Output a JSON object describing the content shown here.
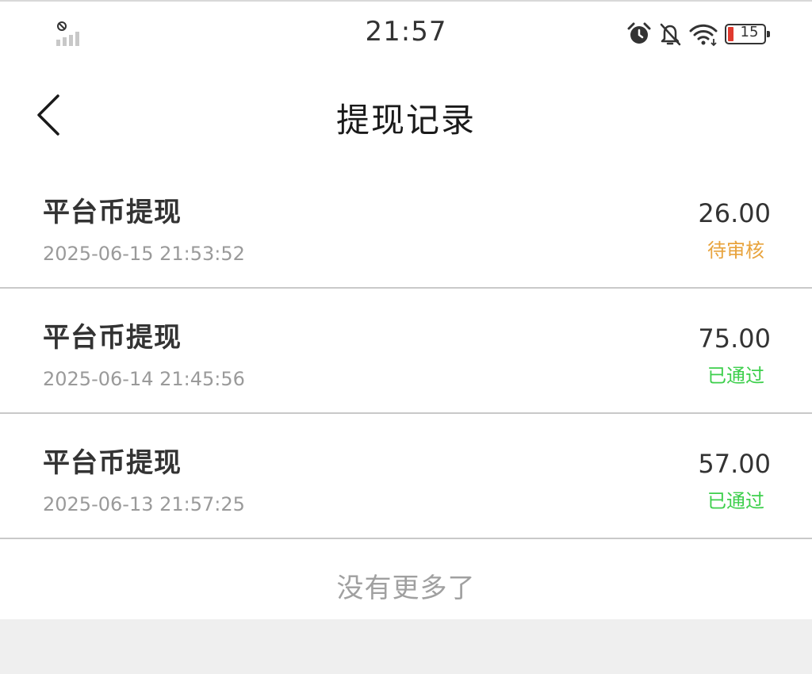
{
  "status_bar": {
    "time": "21:57",
    "battery_level": "15",
    "icons": [
      "signal-off-icon",
      "alarm-icon",
      "bell-off-icon",
      "wifi-icon",
      "battery-icon"
    ]
  },
  "header": {
    "title": "提现记录",
    "back_icon": "chevron-left-icon"
  },
  "records": [
    {
      "title": "平台币提现",
      "time": "2025-06-15 21:53:52",
      "amount": "26.00",
      "status": "待审核",
      "status_color": "#e8a33c"
    },
    {
      "title": "平台币提现",
      "time": "2025-06-14 21:45:56",
      "amount": "75.00",
      "status": "已通过",
      "status_color": "#3dcf4c"
    },
    {
      "title": "平台币提现",
      "time": "2025-06-13 21:57:25",
      "amount": "57.00",
      "status": "已通过",
      "status_color": "#3dcf4c"
    }
  ],
  "footer": {
    "end_text": "没有更多了"
  },
  "colors": {
    "pending": "#e8a33c",
    "approved": "#3dcf4c",
    "battery_low": "#e03a2f"
  }
}
